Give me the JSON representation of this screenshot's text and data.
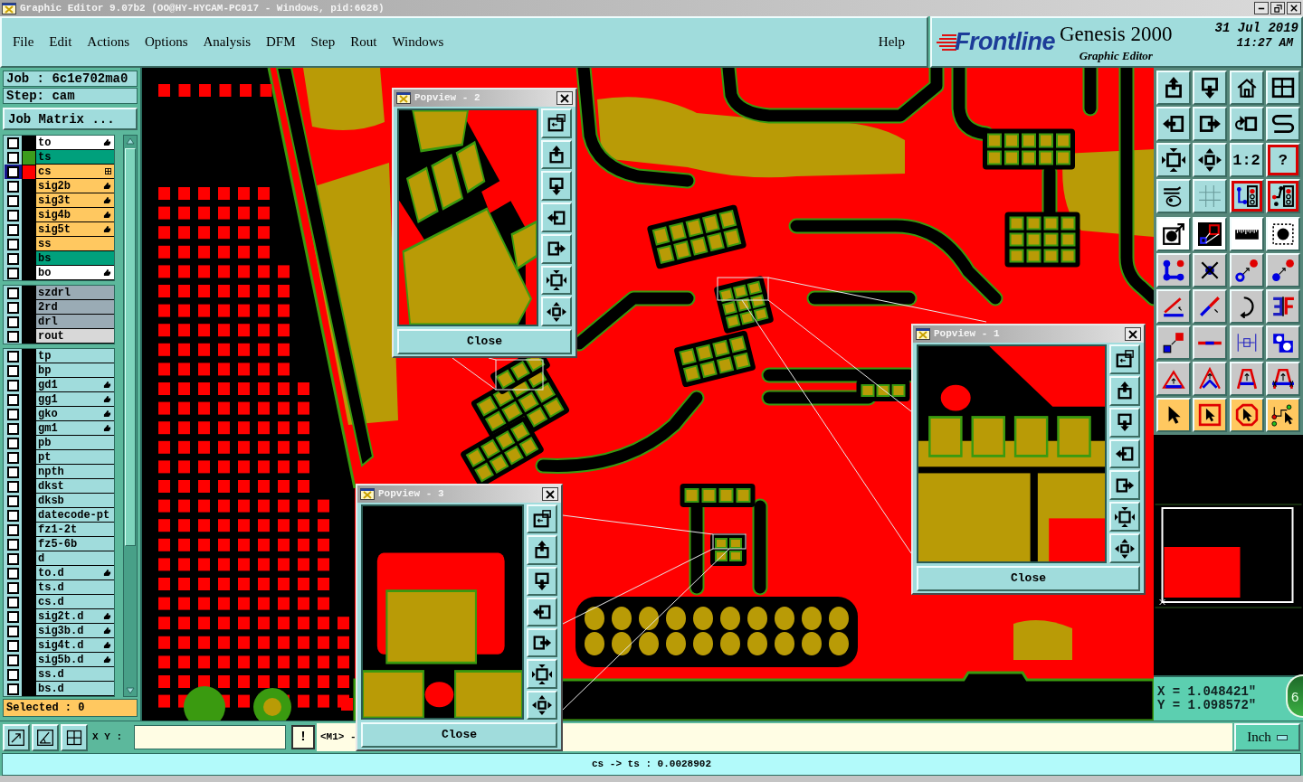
{
  "window": {
    "title": "Graphic Editor 9.07b2 (OO@HY-HYCAM-PC017 - Windows, pid:6628)"
  },
  "menu": {
    "items": [
      "File",
      "Edit",
      "Actions",
      "Options",
      "Analysis",
      "DFM",
      "Step",
      "Rout",
      "Windows"
    ],
    "help": "Help"
  },
  "brand": {
    "logo": "Frontline",
    "product": "Genesis 2000",
    "subtitle": "Graphic Editor",
    "date": "31 Jul 2019",
    "time": "11:27 AM"
  },
  "job_panel": {
    "job": "Job : 6c1e702ma0",
    "step": "Step: cam",
    "matrix_button": "Job Matrix ..."
  },
  "layer_groups": [
    {
      "layers": [
        {
          "name": "to",
          "color": "#ffffff",
          "checked": false,
          "selected": false,
          "flagged": true
        },
        {
          "name": "ts",
          "color": "#00a07c",
          "swatch": {
            "color": "#3c9c1c"
          },
          "checked": false,
          "selected": false,
          "flagged": false
        },
        {
          "name": "cs",
          "color": "#ffc860",
          "swatch": {
            "color": "#ff0000"
          },
          "checked": false,
          "selected": true,
          "flagged": false
        },
        {
          "name": "sig2b",
          "color": "#ffc860",
          "checked": false,
          "selected": false,
          "flagged": true
        },
        {
          "name": "sig3t",
          "color": "#ffc860",
          "checked": false,
          "selected": false,
          "flagged": true
        },
        {
          "name": "sig4b",
          "color": "#ffc860",
          "checked": false,
          "selected": false,
          "flagged": true
        },
        {
          "name": "sig5t",
          "color": "#ffc860",
          "checked": false,
          "selected": false,
          "flagged": true
        },
        {
          "name": "ss",
          "color": "#ffc860",
          "checked": false,
          "selected": false,
          "flagged": false
        },
        {
          "name": "bs",
          "color": "#00a07c",
          "checked": false,
          "selected": false,
          "flagged": false
        },
        {
          "name": "bo",
          "color": "#ffffff",
          "checked": false,
          "selected": false,
          "flagged": true
        }
      ]
    },
    {
      "layers": [
        {
          "name": "szdrl",
          "color": "#9aabb5",
          "checked": false,
          "selected": false,
          "flagged": false
        },
        {
          "name": "2rd",
          "color": "#9aabb5",
          "checked": false,
          "selected": false,
          "flagged": false
        },
        {
          "name": "drl",
          "color": "#9aabb5",
          "checked": false,
          "selected": false,
          "flagged": false
        },
        {
          "name": "rout",
          "color": "#d8d8d8",
          "checked": false,
          "selected": false,
          "flagged": false
        }
      ]
    },
    {
      "layers": [
        {
          "name": "tp",
          "color": "#a0dcdc",
          "checked": false,
          "selected": false,
          "flagged": false
        },
        {
          "name": "bp",
          "color": "#a0dcdc",
          "checked": false,
          "selected": false,
          "flagged": false
        },
        {
          "name": "gd1",
          "color": "#a0dcdc",
          "checked": false,
          "selected": false,
          "flagged": true
        },
        {
          "name": "gg1",
          "color": "#a0dcdc",
          "checked": false,
          "selected": false,
          "flagged": true
        },
        {
          "name": "gko",
          "color": "#a0dcdc",
          "checked": false,
          "selected": false,
          "flagged": true
        },
        {
          "name": "gm1",
          "color": "#a0dcdc",
          "checked": false,
          "selected": false,
          "flagged": true
        },
        {
          "name": "pb",
          "color": "#a0dcdc",
          "checked": false,
          "selected": false,
          "flagged": false
        },
        {
          "name": "pt",
          "color": "#a0dcdc",
          "checked": false,
          "selected": false,
          "flagged": false
        },
        {
          "name": "npth",
          "color": "#a0dcdc",
          "checked": false,
          "selected": false,
          "flagged": false
        },
        {
          "name": "dkst",
          "color": "#a0dcdc",
          "checked": false,
          "selected": false,
          "flagged": false
        },
        {
          "name": "dksb",
          "color": "#a0dcdc",
          "checked": false,
          "selected": false,
          "flagged": false
        },
        {
          "name": "datecode-pt",
          "color": "#a0dcdc",
          "checked": false,
          "selected": false,
          "flagged": false
        },
        {
          "name": "fz1-2t",
          "color": "#a0dcdc",
          "checked": false,
          "selected": false,
          "flagged": false
        },
        {
          "name": "fz5-6b",
          "color": "#a0dcdc",
          "checked": false,
          "selected": false,
          "flagged": false
        },
        {
          "name": "d",
          "color": "#a0dcdc",
          "checked": false,
          "selected": false,
          "flagged": false
        },
        {
          "name": "to.d",
          "color": "#a0dcdc",
          "checked": false,
          "selected": false,
          "flagged": true
        },
        {
          "name": "ts.d",
          "color": "#a0dcdc",
          "checked": false,
          "selected": false,
          "flagged": false
        },
        {
          "name": "cs.d",
          "color": "#a0dcdc",
          "checked": false,
          "selected": false,
          "flagged": false
        },
        {
          "name": "sig2t.d",
          "color": "#a0dcdc",
          "checked": false,
          "selected": false,
          "flagged": true
        },
        {
          "name": "sig3b.d",
          "color": "#a0dcdc",
          "checked": false,
          "selected": false,
          "flagged": true
        },
        {
          "name": "sig4t.d",
          "color": "#a0dcdc",
          "checked": false,
          "selected": false,
          "flagged": true
        },
        {
          "name": "sig5b.d",
          "color": "#a0dcdc",
          "checked": false,
          "selected": false,
          "flagged": true
        },
        {
          "name": "ss.d",
          "color": "#a0dcdc",
          "checked": false,
          "selected": false,
          "flagged": false
        },
        {
          "name": "bs.d",
          "color": "#a0dcdc",
          "checked": false,
          "selected": false,
          "flagged": false
        }
      ]
    }
  ],
  "selected_count": "Selected : 0",
  "popviews": [
    {
      "title": "Popview - 2",
      "close": "Close"
    },
    {
      "title": "Popview - 1",
      "close": "Close"
    },
    {
      "title": "Popview - 3",
      "close": "Close"
    }
  ],
  "toolbar": {
    "view_tools": [
      {
        "on": false
      },
      {
        "on": false
      },
      {
        "on": false
      },
      {
        "on": false
      },
      {
        "on": false
      },
      {
        "on": false
      },
      {
        "on": false
      },
      {
        "on": false
      },
      {
        "on": false
      },
      {
        "on": false
      },
      {
        "on": false,
        "label": "1:2"
      },
      {
        "on": true,
        "label": "?"
      },
      {
        "on": false
      },
      {
        "on": false
      },
      {
        "on": true
      },
      {
        "on": true
      }
    ],
    "edit_tools": [
      {
        "color": "#ffffff"
      },
      {
        "color": "#ffffff"
      },
      {
        "color": "#ffffff"
      },
      {
        "color": "#ffffff"
      },
      {
        "color": "#c8c8c8"
      },
      {
        "color": "#c8c8c8"
      },
      {
        "color": "#c8c8c8"
      },
      {
        "color": "#c8c8c8"
      },
      {
        "color": "#c8c8c8"
      },
      {
        "color": "#c8c8c8"
      },
      {
        "color": "#c8c8c8"
      },
      {
        "color": "#c8c8c8"
      },
      {
        "color": "#c8c8c8"
      },
      {
        "color": "#c8c8c8"
      },
      {
        "color": "#c8c8c8"
      },
      {
        "color": "#c8c8c8"
      },
      {
        "color": "#c8c8c8"
      },
      {
        "color": "#c8c8c8"
      },
      {
        "color": "#c8c8c8"
      },
      {
        "color": "#c8c8c8"
      },
      {
        "color": "#ffc860"
      },
      {
        "color": "#ffc860"
      },
      {
        "color": "#ffc860"
      },
      {
        "color": "#ffc860"
      }
    ]
  },
  "coordinates": {
    "x": "X = 1.048421\"",
    "y": "Y = 1.098572\""
  },
  "overlay_badge": "6",
  "command_bar": {
    "xy_label": "X Y :",
    "alert_button": "!",
    "mode": "<M1> -",
    "units": "Inch"
  },
  "status_bar": {
    "text": "cs -> ts : 0.0028902"
  }
}
